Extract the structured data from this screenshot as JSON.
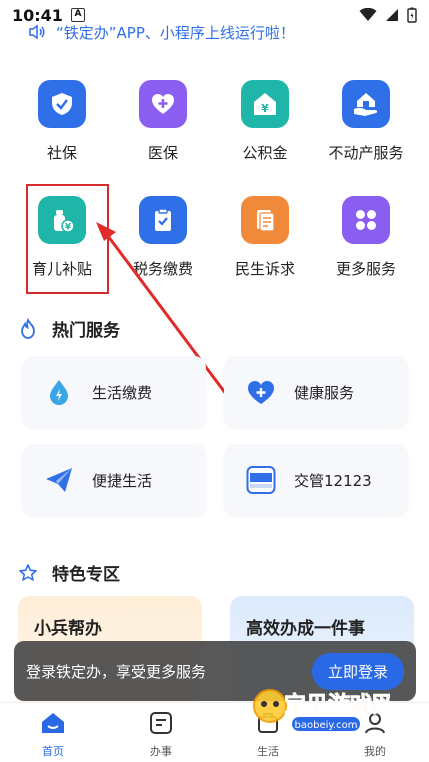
{
  "status_bar": {
    "time": "10:41",
    "a_badge": "A"
  },
  "notice": {
    "text": "“铁定办”APP、小程序上线运行啦！"
  },
  "services": [
    {
      "label": "社保",
      "icon": "shield-check-icon",
      "color": "#2f6fe8"
    },
    {
      "label": "医保",
      "icon": "medical-cross-icon",
      "color": "#8a5ef0"
    },
    {
      "label": "公积金",
      "icon": "housing-fund-icon",
      "color": "#1fb5a8"
    },
    {
      "label": "不动产服务",
      "icon": "house-hand-icon",
      "color": "#2f6fe8"
    },
    {
      "label": "育儿补贴",
      "icon": "baby-bottle-icon",
      "color": "#1fb5a8"
    },
    {
      "label": "税务缴费",
      "icon": "clipboard-check-icon",
      "color": "#2f6fe8"
    },
    {
      "label": "民生诉求",
      "icon": "document-icon",
      "color": "#f08a3a"
    },
    {
      "label": "更多服务",
      "icon": "grid-icon",
      "color": "#8a5ef0"
    }
  ],
  "hot_services": {
    "title": "热门服务",
    "items": [
      {
        "label": "生活缴费",
        "icon": "water-drop-icon"
      },
      {
        "label": "健康服务",
        "icon": "heart-plus-icon"
      },
      {
        "label": "便捷生活",
        "icon": "paper-plane-icon"
      },
      {
        "label": "交管12123",
        "icon": "traffic-12123-icon"
      }
    ]
  },
  "featured": {
    "title": "特色专区",
    "items": [
      {
        "label": "小兵帮办"
      },
      {
        "label": "高效办成一件事"
      }
    ]
  },
  "toast": {
    "text": "登录铁定办，享受更多服务",
    "button": "立即登录"
  },
  "bottom_nav": [
    {
      "label": "首页",
      "active": true
    },
    {
      "label": "办事",
      "active": false
    },
    {
      "label": "生活",
      "active": false
    },
    {
      "label": "我的",
      "active": false
    }
  ],
  "watermark": {
    "title": "宝贝游戏网",
    "url": "baobeiy.com"
  }
}
